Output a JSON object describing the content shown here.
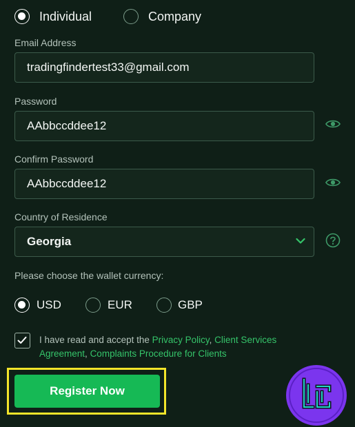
{
  "account_type": {
    "options": [
      {
        "label": "Individual",
        "selected": true
      },
      {
        "label": "Company",
        "selected": false
      }
    ]
  },
  "form": {
    "email": {
      "label": "Email Address",
      "value": "tradingfindertest33@gmail.com"
    },
    "password": {
      "label": "Password",
      "value": "AAbbccddee12"
    },
    "confirm_password": {
      "label": "Confirm Password",
      "value": "AAbbccddee12"
    },
    "country": {
      "label": "Country of Residence",
      "value": "Georgia"
    }
  },
  "currency": {
    "prompt": "Please choose the wallet currency:",
    "options": [
      {
        "label": "USD",
        "selected": true
      },
      {
        "label": "EUR",
        "selected": false
      },
      {
        "label": "GBP",
        "selected": false
      }
    ]
  },
  "terms": {
    "checked": true,
    "prefix": "I have read and accept the ",
    "privacy_policy": "Privacy Policy",
    "sep1": ", ",
    "client": "Client Services Agreement",
    "sep2": ", ",
    "complaints": "Complaints Procedure for Clients"
  },
  "register_button": {
    "label": "Register Now"
  },
  "colors": {
    "background": "#0f1f17",
    "accent_green": "#16b955",
    "link_green": "#35c46a",
    "highlight_yellow": "#f3e52a",
    "logo_purple": "#7b35ee"
  },
  "icons": {
    "password_toggle": "eye-icon",
    "confirm_toggle": "eye-icon",
    "country_dropdown": "chevron-down-icon",
    "country_help": "question-circle-icon",
    "checkbox": "checkmark-icon"
  }
}
